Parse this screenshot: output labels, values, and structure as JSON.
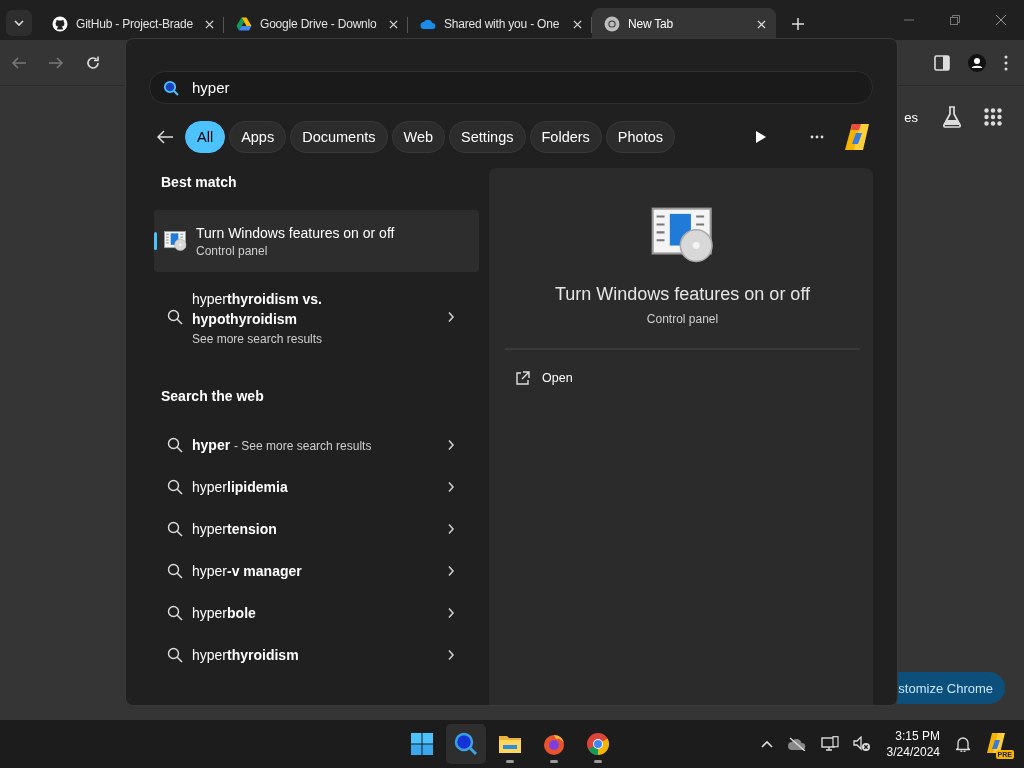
{
  "browser": {
    "tabs": [
      {
        "kind": "github",
        "title": "GitHub - Project-Brade",
        "selected": false
      },
      {
        "kind": "drive",
        "title": "Google Drive - Downlo",
        "selected": false
      },
      {
        "kind": "cloud",
        "title": "Shared with you - One",
        "selected": false
      },
      {
        "kind": "chrome",
        "title": "New Tab",
        "selected": true
      }
    ],
    "page": {
      "shortcut_fragment": "es",
      "customize_button": "stomize Chrome"
    }
  },
  "search": {
    "value": "hyper",
    "filters": [
      {
        "label": "All",
        "selected": true
      },
      {
        "label": "Apps",
        "selected": false
      },
      {
        "label": "Documents",
        "selected": false
      },
      {
        "label": "Web",
        "selected": false
      },
      {
        "label": "Settings",
        "selected": false
      },
      {
        "label": "Folders",
        "selected": false
      },
      {
        "label": "Photos",
        "selected": false
      }
    ],
    "best_match_heading": "Best match",
    "best_match": {
      "title": "Turn Windows features on or off",
      "subtitle": "Control panel",
      "selected": true
    },
    "suggestion": {
      "text": "hyper**thyroidism vs. hypothyroidism**",
      "subtitle": "See more search results"
    },
    "web_heading": "Search the web",
    "web_results": [
      {
        "text": "hyper",
        "note": "- See more search results"
      },
      {
        "text": "hyper**lipidemia**"
      },
      {
        "text": "hyper**tension**"
      },
      {
        "text": "hyper**-v manager**"
      },
      {
        "text": "hyper**bole**"
      },
      {
        "text": "hyper**thyroidism**"
      }
    ],
    "preview": {
      "title": "Turn Windows features on or off",
      "subtitle": "Control panel",
      "actions": [
        {
          "label": "Open"
        }
      ]
    }
  },
  "taskbar": {
    "apps": [
      {
        "kind": "start",
        "running": false,
        "selected": false
      },
      {
        "kind": "search",
        "running": false,
        "selected": true
      },
      {
        "kind": "files",
        "running": true,
        "selected": false
      },
      {
        "kind": "firefox",
        "running": true,
        "selected": false
      },
      {
        "kind": "chrome",
        "running": true,
        "selected": false
      }
    ],
    "time": "3:15 PM",
    "date": "3/24/2024",
    "copilot_badge": "PRE"
  }
}
